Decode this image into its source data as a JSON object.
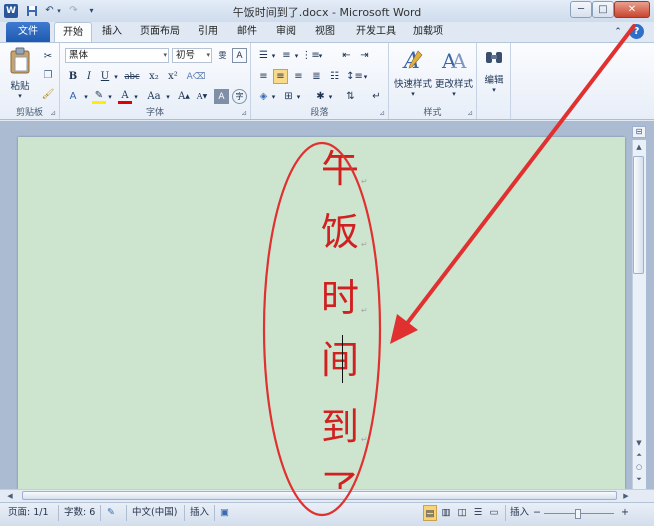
{
  "titlebar": {
    "logo": "W",
    "title": "午饭时间到了.docx - Microsoft Word",
    "minimize": "─",
    "maximize": "□",
    "close": "✕"
  },
  "tabs": [
    "文件",
    "开始",
    "插入",
    "页面布局",
    "引用",
    "邮件",
    "审阅",
    "视图",
    "开发工具",
    "加载项"
  ],
  "ribbon": {
    "clipboard": {
      "label": "剪贴板",
      "paste": "粘贴"
    },
    "font": {
      "label": "字体",
      "font_name": "黑体",
      "font_size": "初号",
      "bold": "B",
      "italic": "I",
      "underline": "U",
      "strike": "abc",
      "subscript": "x₂",
      "superscript": "x²",
      "case": "Aa",
      "grow": "A",
      "shrink": "A"
    },
    "paragraph": {
      "label": "段落"
    },
    "styles": {
      "label": "样式",
      "quick_styles": "快速样式",
      "change_styles": "更改样式"
    },
    "editing": {
      "label": "编辑"
    }
  },
  "document": {
    "characters": [
      "午",
      "饭",
      "时",
      "间",
      "到",
      "了"
    ],
    "paragraph_mark": "↵"
  },
  "statusbar": {
    "page": "页面: 1/1",
    "words": "字数: 6",
    "language": "中文(中国)",
    "mode": "插入"
  },
  "colors": {
    "annotation_red": "#e03030",
    "text_red": "#d12020",
    "page_background": "#cde5cf",
    "file_tab": "#2b62b8"
  }
}
